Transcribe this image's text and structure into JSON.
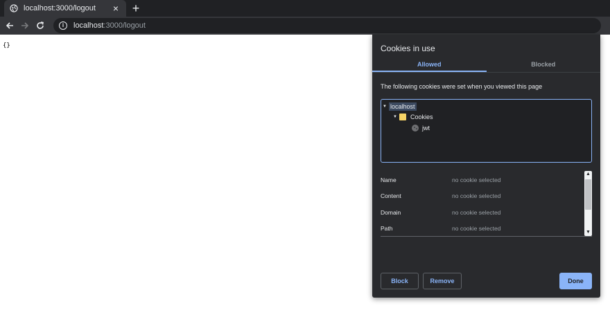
{
  "browser": {
    "tab_title": "localhost:3000/logout",
    "new_tab_label": "+",
    "close_label": "×",
    "url_host": "localhost",
    "url_rest": ":3000/logout"
  },
  "page": {
    "content": "{}"
  },
  "dialog": {
    "title": "Cookies in use",
    "tabs": [
      {
        "label": "Allowed",
        "active": true
      },
      {
        "label": "Blocked",
        "active": false
      }
    ],
    "description": "The following cookies were set when you viewed this page",
    "tree": {
      "root": "localhost",
      "folder": "Cookies",
      "item": "jwt"
    },
    "details": [
      {
        "key": "Name",
        "value": "no cookie selected"
      },
      {
        "key": "Content",
        "value": "no cookie selected"
      },
      {
        "key": "Domain",
        "value": "no cookie selected"
      },
      {
        "key": "Path",
        "value": "no cookie selected"
      }
    ],
    "buttons": {
      "block": "Block",
      "remove": "Remove",
      "done": "Done"
    }
  },
  "colors": {
    "accent": "#8ab4f8",
    "dialog_bg": "#292a2d",
    "folder": "#f6d365"
  }
}
